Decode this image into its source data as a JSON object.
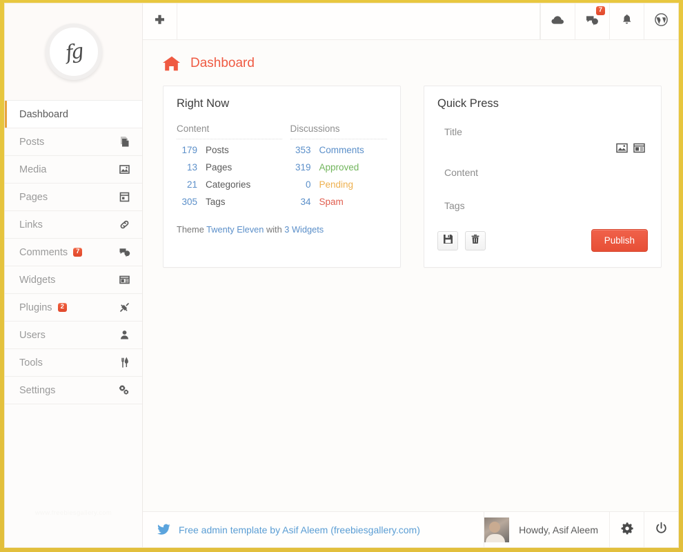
{
  "theme": {
    "frame_color": "#e4c03c",
    "accent_red": "#ef5a42",
    "accent_orange": "#e8a33d",
    "link_blue": "#5b8fc9",
    "ok_green": "#71b55c",
    "warn_amber": "#eeb04e",
    "bad_red": "#e05d4e",
    "badge_red": "#e0482c"
  },
  "sidebar": {
    "logo_glyph": "fg",
    "logo_icon": "signature-logo",
    "watermark": "www.freebiesgallery.com",
    "items": [
      {
        "label": "Dashboard",
        "icon": "",
        "badge": null,
        "active": true
      },
      {
        "label": "Posts",
        "icon": "posts-icon",
        "badge": null,
        "active": false
      },
      {
        "label": "Media",
        "icon": "media-icon",
        "badge": null,
        "active": false
      },
      {
        "label": "Pages",
        "icon": "pages-icon",
        "badge": null,
        "active": false
      },
      {
        "label": "Links",
        "icon": "links-icon",
        "badge": null,
        "active": false
      },
      {
        "label": "Comments",
        "icon": "comments-icon",
        "badge": "7",
        "active": false
      },
      {
        "label": "Widgets",
        "icon": "widgets-icon",
        "badge": null,
        "active": false
      },
      {
        "label": "Plugins",
        "icon": "plugins-icon",
        "badge": "2",
        "active": false
      },
      {
        "label": "Users",
        "icon": "users-icon",
        "badge": null,
        "active": false
      },
      {
        "label": "Tools",
        "icon": "tools-icon",
        "badge": null,
        "active": false
      },
      {
        "label": "Settings",
        "icon": "settings-icon",
        "badge": null,
        "active": false
      }
    ]
  },
  "topbar": {
    "add_icon": "plus-icon",
    "right_buttons": [
      {
        "icon": "cloud-icon",
        "badge": null
      },
      {
        "icon": "comments-icon",
        "badge": "7"
      },
      {
        "icon": "bell-icon",
        "badge": null
      },
      {
        "icon": "wordpress-icon",
        "badge": null
      }
    ]
  },
  "page": {
    "title": "Dashboard",
    "title_icon": "home-icon"
  },
  "right_now": {
    "title": "Right Now",
    "content_header": "Content",
    "discussions_header": "Discussions",
    "content": [
      {
        "count": "179",
        "label": "Posts",
        "style": "plain"
      },
      {
        "count": "13",
        "label": "Pages",
        "style": "plain"
      },
      {
        "count": "21",
        "label": "Categories",
        "style": "plain"
      },
      {
        "count": "305",
        "label": "Tags",
        "style": "plain"
      }
    ],
    "discussions": [
      {
        "count": "353",
        "label": "Comments",
        "style": "link"
      },
      {
        "count": "319",
        "label": "Approved",
        "style": "ok"
      },
      {
        "count": "0",
        "label": "Pending",
        "style": "warn"
      },
      {
        "count": "34",
        "label": "Spam",
        "style": "bad"
      }
    ],
    "theme_prefix": "Theme",
    "theme_name": "Twenty Eleven",
    "theme_mid": "with",
    "theme_widgets": "3 Widgets"
  },
  "quick_press": {
    "title": "Quick Press",
    "title_field": "Title",
    "content_field": "Content",
    "tags_field": "Tags",
    "media_buttons": [
      {
        "icon": "insert-image-icon"
      },
      {
        "icon": "insert-media-icon"
      }
    ],
    "action_buttons": [
      {
        "icon": "save-draft-icon"
      },
      {
        "icon": "trash-icon"
      }
    ],
    "publish_label": "Publish"
  },
  "footer": {
    "twitter_icon": "twitter-bird-icon",
    "credit": "Free admin template by Asif Aleem (freebiesgallery.com)",
    "avatar": "user-avatar",
    "greeting": "Howdy, Asif Aleem",
    "settings_icon": "gear-icon",
    "logout_icon": "power-icon"
  }
}
